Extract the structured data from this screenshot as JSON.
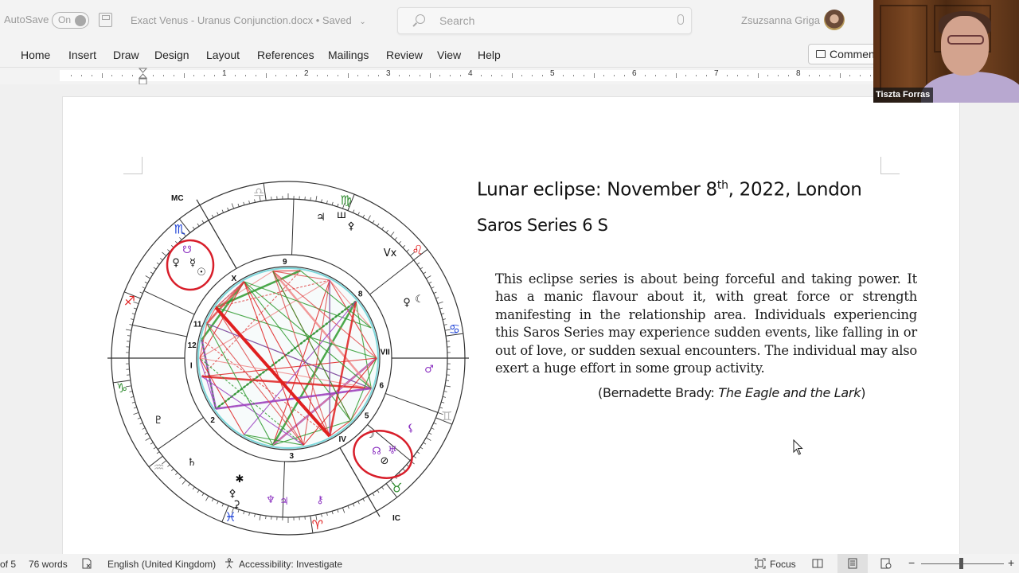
{
  "titlebar": {
    "autosave_label": "AutoSave",
    "autosave_state": "On",
    "document_title": "Exact Venus - Uranus Conjunction.docx",
    "save_status": "• Saved",
    "search_placeholder": "Search",
    "user_name": "Zsuzsanna Griga"
  },
  "ribbon": {
    "tabs": [
      "Home",
      "Insert",
      "Draw",
      "Design",
      "Layout",
      "References",
      "Mailings",
      "Review",
      "View",
      "Help"
    ],
    "comments_label": "Comments"
  },
  "ruler": {
    "numbers": [
      "1",
      "2",
      "3",
      "4",
      "5",
      "6",
      "7",
      "8"
    ]
  },
  "document": {
    "heading_main": "Lunar eclipse: November 8",
    "heading_sup": "th",
    "heading_rest": ", 2022, London",
    "subheading": "Saros Series 6 S",
    "quote": "This eclipse series is about being forceful and taking power. It has a manic flavour about it, with great force or strength manifesting in the relationship area. Individuals experiencing this Saros Series may experience sudden events, like falling in or out of love, or sudden sexual encounters. The individual may also exert a huge effort in some group activity.",
    "citation_prefix": "(Bernadette Brady: ",
    "citation_title": "The Eagle and the Lark",
    "citation_suffix": ")"
  },
  "astro_chart": {
    "angle_labels": {
      "mc": "MC",
      "ic": "IC"
    },
    "house_numbers": [
      "I",
      "2",
      "3",
      "IV",
      "5",
      "6",
      "VII",
      "8",
      "9",
      "X",
      "11",
      "12"
    ],
    "signs": [
      {
        "name": "libra",
        "glyph": "♎",
        "color": "#b5b5b5"
      },
      {
        "name": "virgo",
        "glyph": "♍",
        "color": "#2e8b2e"
      },
      {
        "name": "leo",
        "glyph": "♌",
        "color": "#e02020"
      },
      {
        "name": "cancer",
        "glyph": "♋",
        "color": "#1a3fd6"
      },
      {
        "name": "gemini",
        "glyph": "♊",
        "color": "#b5b5b5"
      },
      {
        "name": "taurus",
        "glyph": "♉",
        "color": "#2e8b2e"
      },
      {
        "name": "aries",
        "glyph": "♈",
        "color": "#e02020"
      },
      {
        "name": "pisces",
        "glyph": "♓",
        "color": "#1a3fd6"
      },
      {
        "name": "aquarius",
        "glyph": "♒",
        "color": "#b5b5b5"
      },
      {
        "name": "capricorn",
        "glyph": "♑",
        "color": "#2e8b2e"
      },
      {
        "name": "sagittarius",
        "glyph": "♐",
        "color": "#e02020"
      },
      {
        "name": "scorpio",
        "glyph": "♏",
        "color": "#1a3fd6"
      }
    ],
    "planets": [
      {
        "name": "venus",
        "glyph": "♀",
        "color": "#111"
      },
      {
        "name": "mercury",
        "glyph": "☿",
        "color": "#111"
      },
      {
        "name": "sun",
        "glyph": "☉",
        "color": "#111"
      },
      {
        "name": "south-node",
        "glyph": "☋",
        "color": "#8a2fc0"
      },
      {
        "name": "jupiter-virgo",
        "glyph": "♃",
        "color": "#111"
      },
      {
        "name": "uranus-virgo",
        "glyph": "ш",
        "color": "#111"
      },
      {
        "name": "asteroid",
        "glyph": "⚴",
        "color": "#111"
      },
      {
        "name": "vertex",
        "glyph": "Vx",
        "color": "#111"
      },
      {
        "name": "venus-cancer",
        "glyph": "♀",
        "color": "#111"
      },
      {
        "name": "moon-cancer",
        "glyph": "☾",
        "color": "#111"
      },
      {
        "name": "mars",
        "glyph": "♂",
        "color": "#8a2fc0"
      },
      {
        "name": "moon",
        "glyph": "☽",
        "color": "#111"
      },
      {
        "name": "north-node",
        "glyph": "☊",
        "color": "#8a2fc0"
      },
      {
        "name": "uranus",
        "glyph": "♅",
        "color": "#8a2fc0"
      },
      {
        "name": "part-of-fortune",
        "glyph": "⊘",
        "color": "#111"
      },
      {
        "name": "lilith",
        "glyph": "⚸",
        "color": "#8a2fc0"
      },
      {
        "name": "chiron",
        "glyph": "⚷",
        "color": "#8a2fc0"
      },
      {
        "name": "neptune",
        "glyph": "♆",
        "color": "#8a2fc0"
      },
      {
        "name": "jupiter",
        "glyph": "♃",
        "color": "#8a2fc0"
      },
      {
        "name": "ceres",
        "glyph": "⚳",
        "color": "#111"
      },
      {
        "name": "juno",
        "glyph": "✱",
        "color": "#111"
      },
      {
        "name": "pallas",
        "glyph": "⚴",
        "color": "#111"
      },
      {
        "name": "saturn",
        "glyph": "♄",
        "color": "#111"
      },
      {
        "name": "pluto",
        "glyph": "♇",
        "color": "#111"
      }
    ],
    "highlight_color": "#d81e2a"
  },
  "video": {
    "participant_name": "Tiszta Forras"
  },
  "statusbar": {
    "page_info": "of 5",
    "word_count": "76 words",
    "language": "English (United Kingdom)",
    "accessibility": "Accessibility: Investigate",
    "focus_label": "Focus",
    "zoom_minus": "−",
    "zoom_plus": "+"
  }
}
